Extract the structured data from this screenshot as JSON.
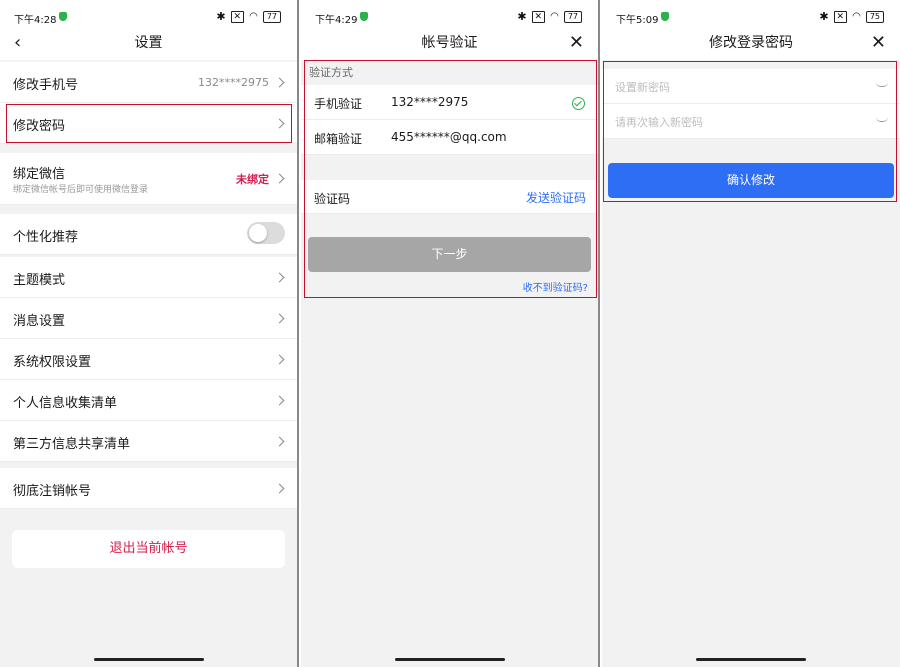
{
  "screen1": {
    "status": {
      "time": "下午4:28",
      "battery": "77"
    },
    "title": "设置",
    "change_phone": {
      "label": "修改手机号",
      "value": "132****2975"
    },
    "change_password": {
      "label": "修改密码"
    },
    "bind_wechat": {
      "label": "绑定微信",
      "sub": "绑定微信帐号后即可使用微信登录",
      "status": "未绑定"
    },
    "personal_recommend": {
      "label": "个性化推荐"
    },
    "theme": {
      "label": "主题模式"
    },
    "messages": {
      "label": "消息设置"
    },
    "permissions": {
      "label": "系统权限设置"
    },
    "info_list": {
      "label": "个人信息收集清单"
    },
    "third_party": {
      "label": "第三方信息共享清单"
    },
    "cancel_account": {
      "label": "彻底注销帐号"
    },
    "logout": {
      "label": "退出当前帐号"
    }
  },
  "screen2": {
    "status": {
      "time": "下午4:29",
      "battery": "77"
    },
    "title": "帐号验证",
    "method_header": "验证方式",
    "phone": {
      "label": "手机验证",
      "value": "132****2975"
    },
    "email": {
      "label": "邮箱验证",
      "value": "455******@qq.com"
    },
    "code": {
      "label": "验证码",
      "action": "发送验证码"
    },
    "next_button": "下一步",
    "no_code": "收不到验证码?"
  },
  "screen3": {
    "status": {
      "time": "下午5:09",
      "battery": "75"
    },
    "title": "修改登录密码",
    "new_password_placeholder": "设置新密码",
    "confirm_password_placeholder": "请再次输入新密码",
    "confirm_button": "确认修改"
  },
  "colors": {
    "accent_blue": "#2d6ef5",
    "danger_red": "#d6204e",
    "highlight": "#c8102e",
    "success_green": "#2bb24c"
  },
  "icons": [
    "back-arrow-icon",
    "close-icon",
    "chevron-right-icon",
    "check-circle-icon",
    "eye-closed-icon",
    "bluetooth-icon",
    "wifi-icon",
    "battery-icon"
  ]
}
